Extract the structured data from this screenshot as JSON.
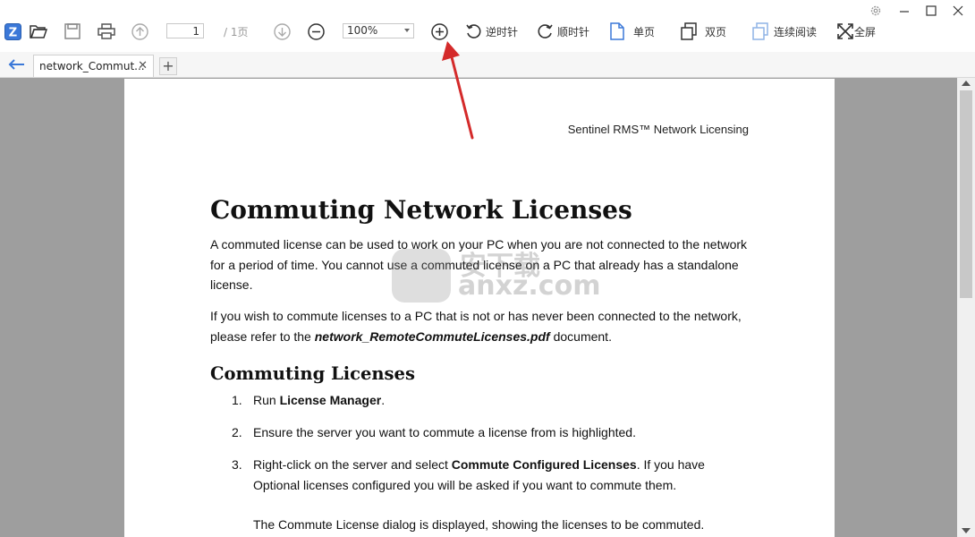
{
  "toolbar": {
    "page_current": "1",
    "page_total": "/ 1页",
    "zoom": "100%",
    "rotate_ccw_label": "逆时针",
    "rotate_cw_label": "顺时针",
    "single_page_label": "单页",
    "double_page_label": "双页",
    "continuous_label": "连续阅读",
    "fullscreen_label": "全屏"
  },
  "tabs": {
    "active_tab": "network_Commut..."
  },
  "document": {
    "running_header": "Sentinel RMS™ Network Licensing",
    "title": "Commuting Network Licenses",
    "para1": "A commuted license can be used to work on your PC when you are not connected to the network for a period of time. You cannot use a commuted license on a PC that already has a standalone license.",
    "para2_pre": "If you wish to commute licenses to a PC that is not or has never been connected to the network, please refer to the ",
    "para2_file": "network_RemoteCommuteLicenses.pdf",
    "para2_post": " document.",
    "subheading": "Commuting Licenses",
    "steps": [
      {
        "num": "1.",
        "pre": "Run ",
        "bold": "License Manager",
        "post": "."
      },
      {
        "num": "2.",
        "pre": "Ensure the server you want to commute a license from is highlighted.",
        "bold": "",
        "post": ""
      },
      {
        "num": "3.",
        "pre": "Right-click on the server and select ",
        "bold": "Commute Configured Licenses",
        "post": ".  If you have Optional licenses configured you will be asked if you want to commute them."
      }
    ],
    "note": "The Commute License dialog is displayed, showing the licenses to be commuted."
  },
  "watermark": {
    "text": "anxz.com",
    "cn": "安下载"
  },
  "colors": {
    "viewer_bg": "#9e9e9e",
    "annotation_arrow": "#d42a2a",
    "app_icon": "#3b78d8"
  }
}
